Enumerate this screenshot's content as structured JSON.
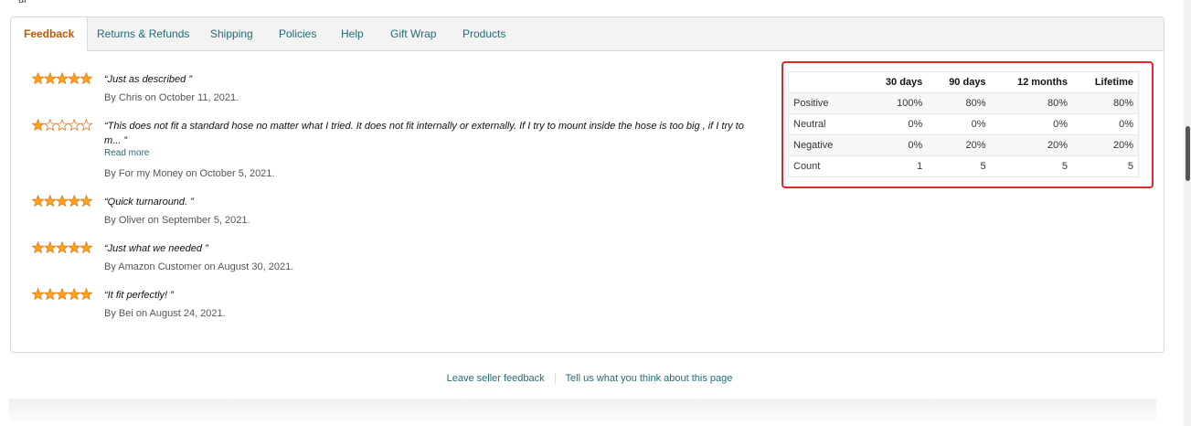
{
  "breadcrumb_fragment": "ur",
  "tabs": [
    {
      "label": "Feedback",
      "active": true
    },
    {
      "label": "Returns & Refunds"
    },
    {
      "label": "Shipping"
    },
    {
      "label": "Policies"
    },
    {
      "label": "Help"
    },
    {
      "label": "Gift Wrap"
    },
    {
      "label": "Products"
    }
  ],
  "reviews": [
    {
      "rating": 5,
      "quote": "“Just as described ”",
      "byline": "By Chris on October 11, 2021."
    },
    {
      "rating": 1,
      "quote": "“This does not fit a standard hose no matter what I tried. It does not fit internally or externally. If I try to mount inside the hose is too big , if I try to m... ”",
      "read_more": "Read more",
      "byline": "By For my Money on October 5, 2021."
    },
    {
      "rating": 5,
      "quote": "“Quick turnaround. ”",
      "byline": "By Oliver on September 5, 2021."
    },
    {
      "rating": 5,
      "quote": "“Just what we needed ”",
      "byline": "By Amazon Customer on August 30, 2021."
    },
    {
      "rating": 5,
      "quote": "“It fit perfectly! ”",
      "byline": "By Bei on August 24, 2021."
    }
  ],
  "stats": {
    "headers": [
      "",
      "30 days",
      "90 days",
      "12 months",
      "Lifetime"
    ],
    "rows": [
      {
        "label": "Positive",
        "values": [
          "100%",
          "80%",
          "80%",
          "80%"
        ],
        "tone": "pos"
      },
      {
        "label": "Neutral",
        "values": [
          "0%",
          "0%",
          "0%",
          "0%"
        ],
        "tone": ""
      },
      {
        "label": "Negative",
        "values": [
          "0%",
          "20%",
          "20%",
          "20%"
        ],
        "tone": "neg"
      },
      {
        "label": "Count",
        "values": [
          "1",
          "5",
          "5",
          "5"
        ],
        "tone": ""
      }
    ]
  },
  "footer": {
    "leave_feedback": "Leave seller feedback",
    "tell_us": "Tell us what you think about this page"
  },
  "colors": {
    "star_filled": "#ffa41c",
    "star_empty": "#de7921",
    "accent_tab": "#c45500",
    "link": "#1f6b7a",
    "positive": "#067d06",
    "negative": "#c40000",
    "highlight": "#e3262a"
  }
}
